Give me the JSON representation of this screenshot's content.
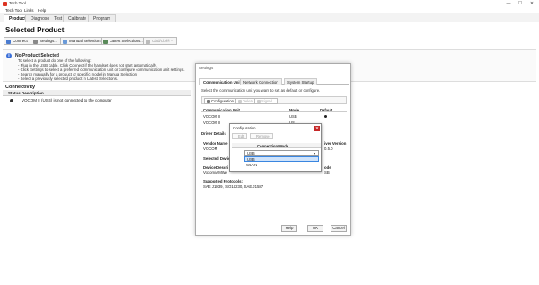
{
  "window": {
    "title": "Tech Tool",
    "controls": [
      "—",
      "☐",
      "✕"
    ]
  },
  "menu": [
    "Tech Tool",
    "Links",
    "Help"
  ],
  "tabs": [
    {
      "label": "Product",
      "active": true
    },
    {
      "label": "Diagnose",
      "active": false
    },
    {
      "label": "Test",
      "active": false
    },
    {
      "label": "Calibrate",
      "active": false
    },
    {
      "label": "Program",
      "active": false
    }
  ],
  "page_title": "Selected Product",
  "toolbar": {
    "connect": "Connect",
    "settings": "Settings...",
    "manual": "Manual Selection...",
    "latest": "Latest Selections...",
    "obd": "Obd/Obl® ▾"
  },
  "info": {
    "heading": "No Product Selected",
    "lines": [
      "To select a product do one of the following:",
      "- Plug in the USB cable. Click Connect if the handset does not start automatically.",
      "- Click Settings to select a preferred communication unit or configure communication unit settings.",
      "- Search manually for a product or specific model in Manual Selection.",
      "- Select a previously selected product in Latest Selections."
    ]
  },
  "connectivity": {
    "title": "Connectivity",
    "headers": [
      "Status",
      "Description"
    ],
    "row": "VOCOM II (USB) is not connected to the computer"
  },
  "dialog": {
    "title": "Settings",
    "tabs": [
      "Communication Unit",
      "Network Connection",
      "System Startup"
    ],
    "description": "Select the communication unit you want to set as default or configure.",
    "tools": [
      "Configuration...",
      "Delete",
      "Signal..."
    ],
    "table_headers": [
      "Communication Unit",
      "Mode",
      "Default"
    ],
    "rows": [
      {
        "unit": "VOCOM II",
        "mode": "USB"
      },
      {
        "unit": "VOCOM II",
        "mode": "US..."
      }
    ],
    "driver_details": "Driver Details",
    "vendor_name_label": "Vendor Name",
    "vendor_name": "VOCOM",
    "driver_version_label": "iver Version",
    "driver_version": "0.5.0",
    "selected_device": "Selected Device",
    "device_desc_label": "Device Descri",
    "device_desc": "Vocom/VMWe",
    "mode_label": "ode",
    "mode_value": "SB",
    "protocols_label": "Supported Protocols:",
    "protocols": "SAE J1939, ISO14230, SAE J1587",
    "buttons": [
      "Help",
      "OK",
      "Cancel"
    ]
  },
  "popup": {
    "title": "Configuration",
    "close": "✕",
    "tools": [
      "Edit",
      "Remove"
    ],
    "column": "Connection Mode",
    "current": "USB",
    "arrow": "▾",
    "options": [
      "USB",
      "WLAN"
    ]
  }
}
